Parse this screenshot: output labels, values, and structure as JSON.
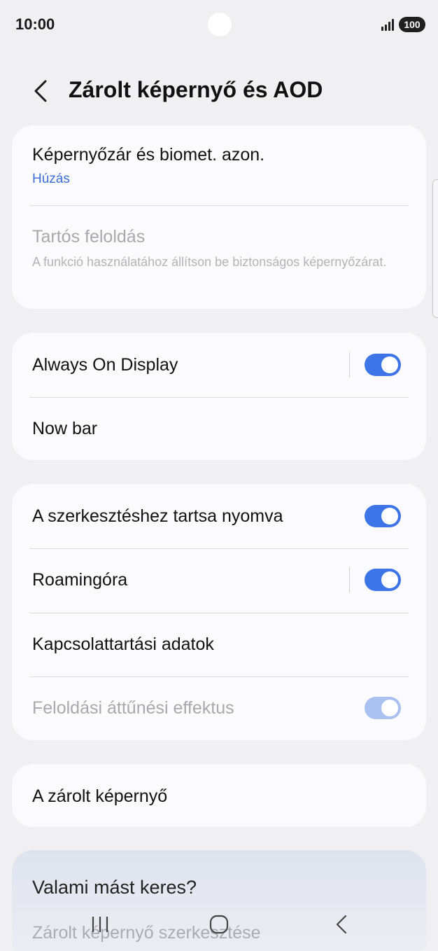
{
  "status": {
    "time": "10:00",
    "battery": "100"
  },
  "header": {
    "title": "Zárolt képernyő és AOD"
  },
  "card1": {
    "row1_title": "Képernyőzár és biomet. azon.",
    "row1_sub": "Húzás",
    "row2_title": "Tartós feloldás",
    "row2_desc": "A funkció használatához állítson be biztonságos képernyőzárat."
  },
  "card2": {
    "row1_title": "Always On Display",
    "row1_toggle_on": true,
    "row2_title": "Now bar"
  },
  "card3": {
    "row1_title": "A szerkesztéshez tartsa nyomva",
    "row1_toggle_on": true,
    "row2_title": "Roamingóra",
    "row2_toggle_on": true,
    "row3_title": "Kapcsolattartási adatok",
    "row4_title": "Feloldási áttűnési effektus",
    "row4_toggle_on": true
  },
  "card4": {
    "row1_title": "A zárolt képernyő"
  },
  "suggest": {
    "title": "Valami mást keres?",
    "item1": "Zárolt képernyő szerkesztése"
  },
  "colors": {
    "accent": "#3d74e8",
    "link": "#3d6fd6",
    "background": "#f0f0f2",
    "card": "#fbfbfd"
  },
  "icons": {
    "back": "chevron-left-icon",
    "recents": "recents-icon",
    "home": "home-icon",
    "nav_back": "nav-back-icon",
    "signal": "signal-icon"
  }
}
